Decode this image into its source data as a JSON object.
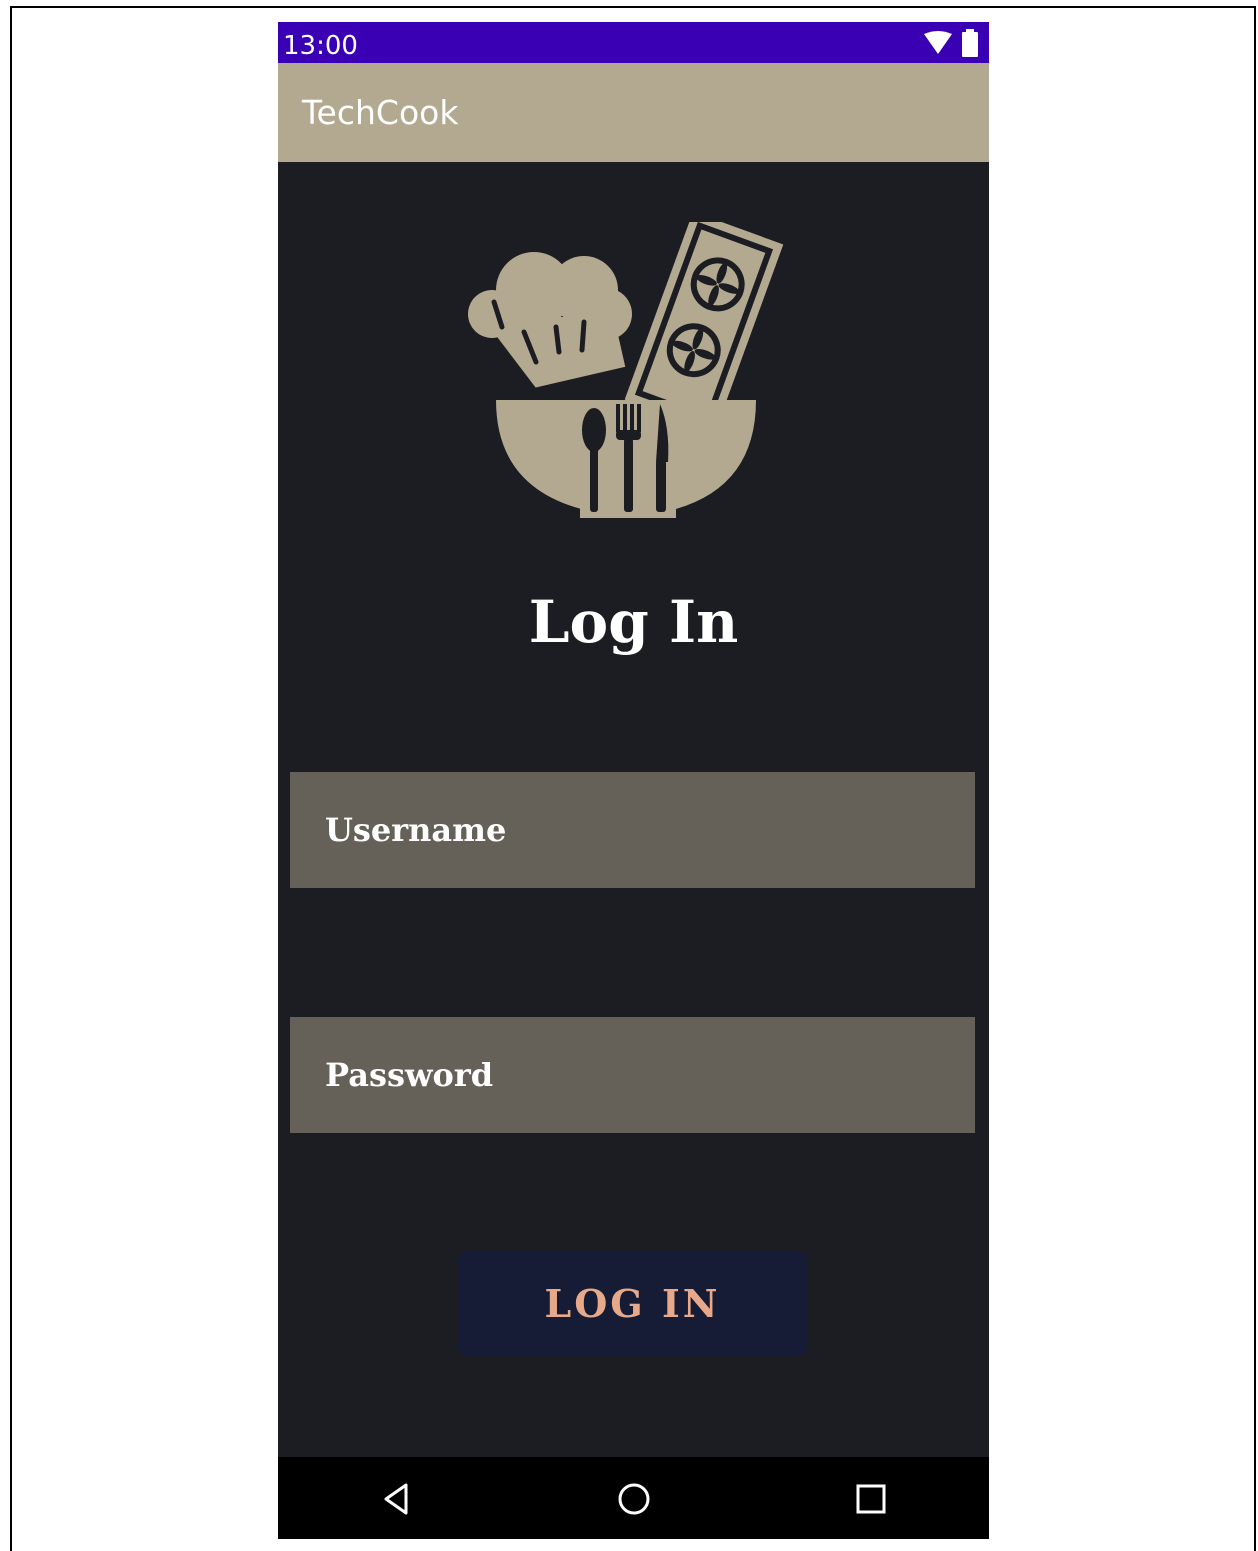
{
  "status_bar": {
    "time": "13:00",
    "icons": [
      "wifi-icon",
      "battery-icon"
    ]
  },
  "app_bar": {
    "title": "TechCook"
  },
  "logo": {
    "icon": "chef-bowl-logo"
  },
  "login": {
    "heading": "Log In",
    "username_placeholder": "Username",
    "password_placeholder": "Password",
    "button_label": "LOG IN"
  },
  "nav_bar": {
    "icons": [
      "back-icon",
      "home-icon",
      "recents-icon"
    ]
  },
  "colors": {
    "status_bar": "#3a00b3",
    "app_bar": "#b3a890",
    "background": "#1b1d22",
    "field": "#666158",
    "button": "#171c36",
    "button_text": "#e7a98a"
  }
}
